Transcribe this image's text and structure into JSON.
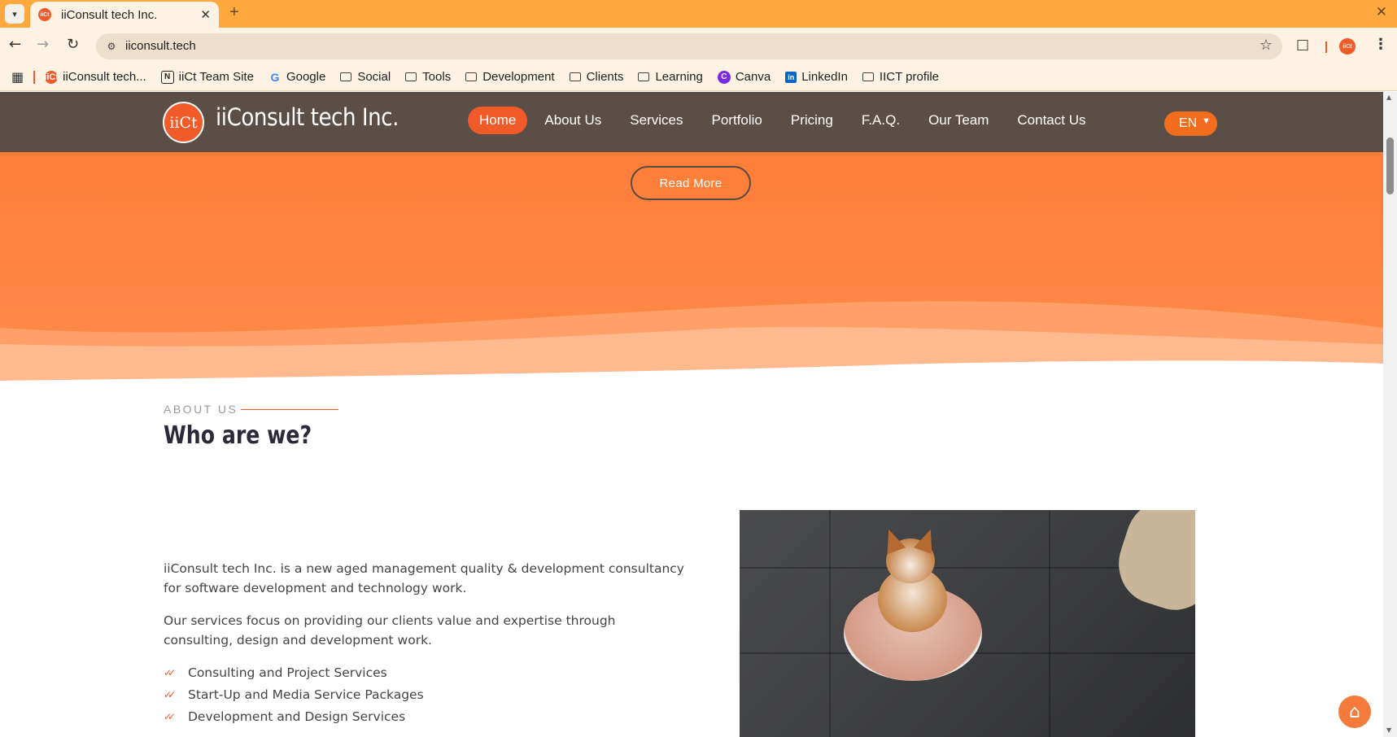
{
  "browser": {
    "tab_title": "iiConsult tech Inc.",
    "favicon_text": "iiCt",
    "url": "iiconsult.tech",
    "bookmarks": [
      {
        "label": "iiConsult tech...",
        "icon": "iict-favicon"
      },
      {
        "label": "iiCt Team Site",
        "icon": "notion-icon"
      },
      {
        "label": "Google",
        "icon": "google-icon"
      },
      {
        "label": "Social",
        "icon": "folder-icon"
      },
      {
        "label": "Tools",
        "icon": "folder-icon"
      },
      {
        "label": "Development",
        "icon": "folder-icon"
      },
      {
        "label": "Clients",
        "icon": "folder-icon"
      },
      {
        "label": "Learning",
        "icon": "folder-icon"
      },
      {
        "label": "Canva",
        "icon": "canva-icon"
      },
      {
        "label": "LinkedIn",
        "icon": "linkedin-icon"
      },
      {
        "label": "IICT profile",
        "icon": "folder-icon"
      }
    ]
  },
  "site": {
    "logo_text": "iiCt",
    "brand_name": "iiConsult tech Inc.",
    "nav": [
      "Home",
      "About Us",
      "Services",
      "Portfolio",
      "Pricing",
      "F.A.Q.",
      "Our Team",
      "Contact Us"
    ],
    "active_nav": "Home",
    "language": "EN",
    "hero_button": "Read More"
  },
  "about": {
    "eyebrow": "ABOUT US",
    "title": "Who are we?",
    "paragraph1": "iiConsult tech Inc. is a new aged management quality & development consultancy for software development and technology work.",
    "paragraph2": "Our services focus on providing our clients value and expertise through consulting, design and development work.",
    "services": [
      "Consulting and Project Services",
      "Start-Up and Media Service Packages",
      "Development and Design Services"
    ]
  },
  "colors": {
    "brand_orange": "#f15a29",
    "hero_orange": "#ff7a33",
    "header_bg": "#564c48",
    "tabstrip": "#fea83d"
  }
}
